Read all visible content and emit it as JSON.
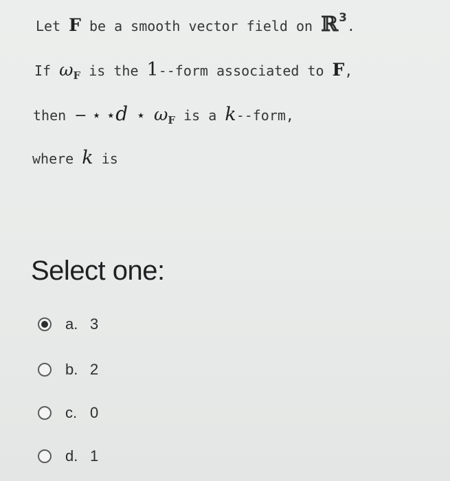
{
  "question": {
    "line1": {
      "let": "Let",
      "F": "F",
      "text": "be a smooth vector field on",
      "R": "ℝ",
      "exp": "3",
      "end": "."
    },
    "line2": {
      "if": "If",
      "omega": "ω",
      "sub": "F",
      "text1": "is the",
      "one": "1",
      "text2": "--form associated to",
      "F": "F",
      "end": ","
    },
    "line3": {
      "then": "then",
      "op": "− ⋆ ⋆",
      "d": "d",
      "star": "⋆",
      "omega": "ω",
      "sub": "F",
      "text1": "is a",
      "k": "k",
      "text2": "--form,"
    },
    "line4": {
      "where": "where",
      "k": "k",
      "is": "is"
    }
  },
  "select_heading": "Select one:",
  "options": [
    {
      "letter": "a.",
      "value": "3",
      "selected": true
    },
    {
      "letter": "b.",
      "value": "2",
      "selected": false
    },
    {
      "letter": "c.",
      "value": "0",
      "selected": false
    },
    {
      "letter": "d.",
      "value": "1",
      "selected": false
    }
  ]
}
